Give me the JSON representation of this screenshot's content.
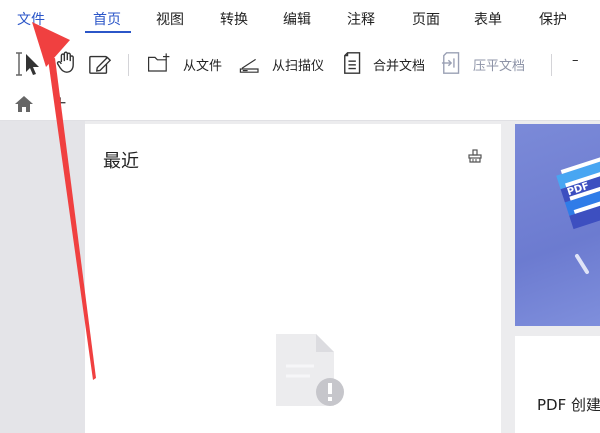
{
  "menu": {
    "file": "文件",
    "items": [
      "首页",
      "视图",
      "转换",
      "编辑",
      "注释",
      "页面",
      "表单",
      "保护"
    ],
    "active": "首页"
  },
  "toolbar": {
    "from_file": "从文件",
    "from_scanner": "从扫描仪",
    "merge_docs": "合并文档",
    "flatten_docs": "压平文档",
    "minimize": "–"
  },
  "tabs": {
    "add": "+"
  },
  "recent": {
    "title": "最近"
  },
  "banner": {
    "badge": "PDF"
  },
  "card": {
    "title": "PDF 创建"
  },
  "colors": {
    "accent": "#2b56c8",
    "annotation_arrow": "#f04040"
  }
}
